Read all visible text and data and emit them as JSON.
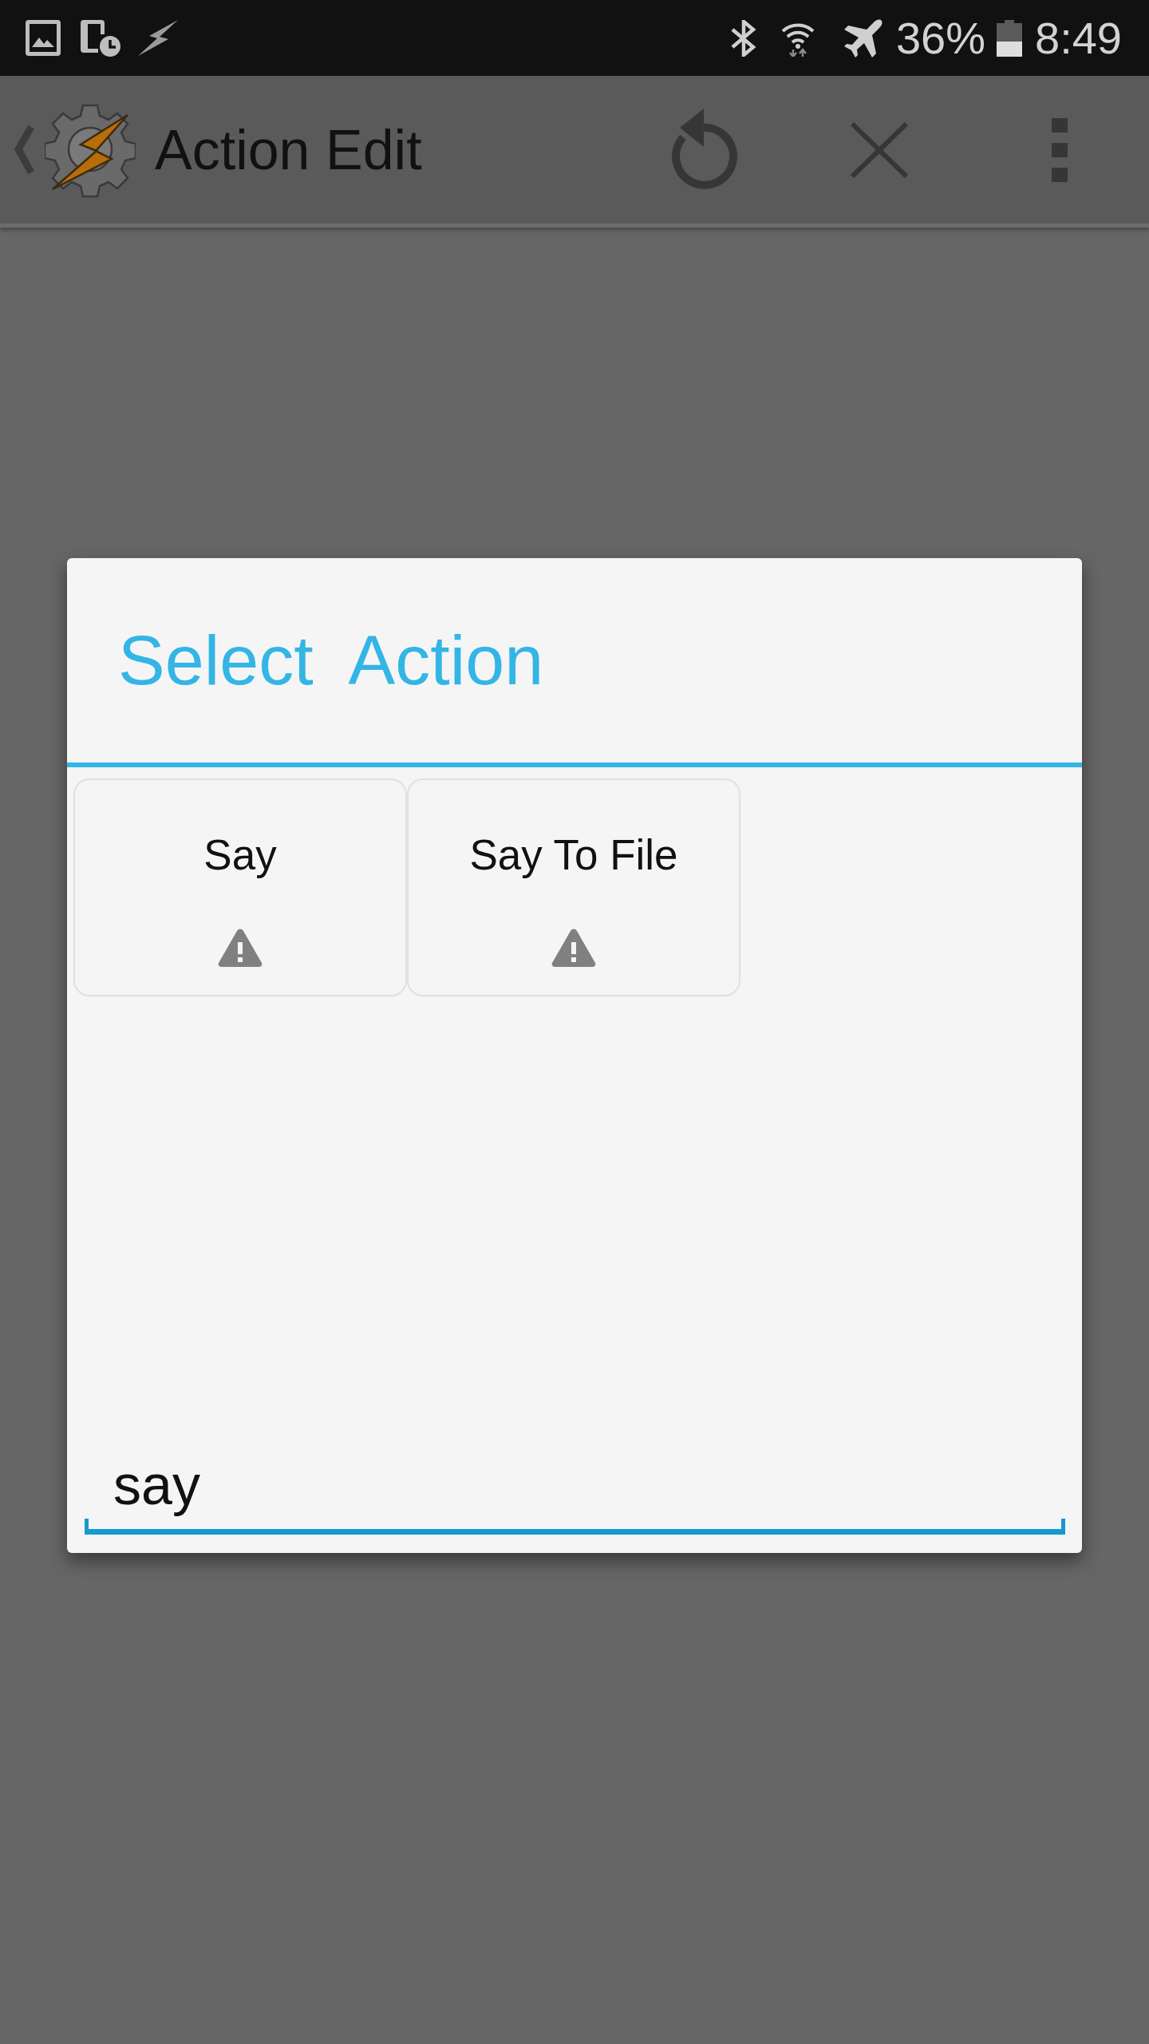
{
  "status_bar": {
    "battery": "36%",
    "time": "8:49"
  },
  "app_bar": {
    "title": "Action Edit"
  },
  "dialog": {
    "title": "Select  Action",
    "actions": [
      {
        "label": "Say",
        "warning": true
      },
      {
        "label": "Say To File",
        "warning": true
      }
    ],
    "search": {
      "value": "say"
    }
  }
}
